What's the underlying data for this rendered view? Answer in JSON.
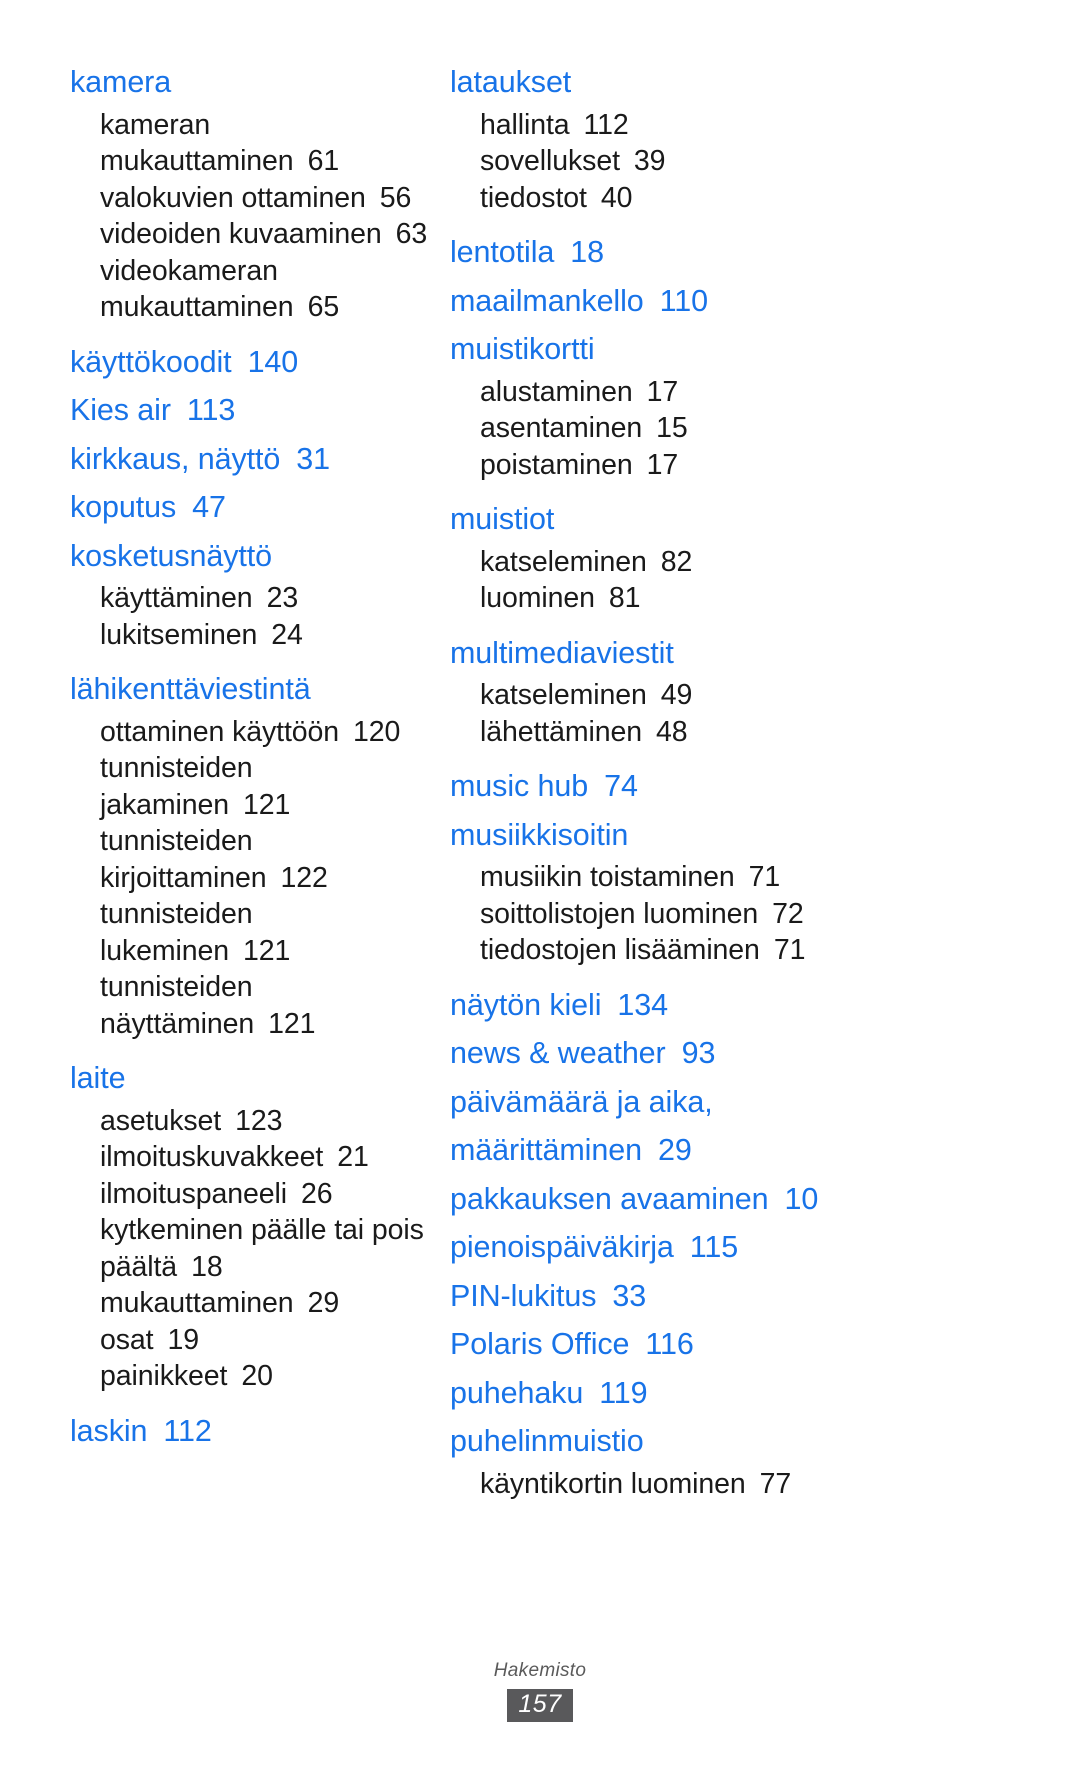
{
  "document": {
    "type": "index-page",
    "footer_label": "Hakemisto",
    "page_number": "157",
    "accent_color": "#1873e8",
    "text_color": "#1a1a1a",
    "footer_badge_color": "#59595b"
  },
  "left_column": {
    "groups": [
      {
        "heading": "kamera",
        "heading_page": "",
        "subs": [
          {
            "label": "kameran",
            "page": ""
          },
          {
            "label": "mukauttaminen",
            "page": "61"
          },
          {
            "label": "valokuvien ottaminen",
            "page": "56"
          },
          {
            "label": "videoiden kuvaaminen",
            "page": "63"
          },
          {
            "label": "videokameran",
            "page": ""
          },
          {
            "label": "mukauttaminen",
            "page": "65"
          }
        ]
      },
      {
        "heading": "käyttökoodit",
        "heading_page": "140",
        "subs": []
      },
      {
        "heading": "Kies air",
        "heading_page": "113",
        "subs": []
      },
      {
        "heading": "kirkkaus, näyttö",
        "heading_page": "31",
        "subs": []
      },
      {
        "heading": "koputus",
        "heading_page": "47",
        "subs": []
      },
      {
        "heading": "kosketusnäyttö",
        "heading_page": "",
        "subs": [
          {
            "label": "käyttäminen",
            "page": "23"
          },
          {
            "label": "lukitseminen",
            "page": "24"
          }
        ]
      },
      {
        "heading": "lähikenttäviestintä",
        "heading_page": "",
        "subs": [
          {
            "label": "ottaminen käyttöön",
            "page": "120"
          },
          {
            "label": "tunnisteiden",
            "page": ""
          },
          {
            "label": "jakaminen",
            "page": "121"
          },
          {
            "label": "tunnisteiden",
            "page": ""
          },
          {
            "label": "kirjoittaminen",
            "page": "122"
          },
          {
            "label": "tunnisteiden",
            "page": ""
          },
          {
            "label": "lukeminen",
            "page": "121"
          },
          {
            "label": "tunnisteiden",
            "page": ""
          },
          {
            "label": "näyttäminen",
            "page": "121"
          }
        ]
      },
      {
        "heading": "laite",
        "heading_page": "",
        "subs": [
          {
            "label": "asetukset",
            "page": "123"
          },
          {
            "label": "ilmoituskuvakkeet",
            "page": "21"
          },
          {
            "label": "ilmoituspaneeli",
            "page": "26"
          },
          {
            "label": "kytkeminen päälle tai pois",
            "page": ""
          },
          {
            "label": "päältä",
            "page": "18"
          },
          {
            "label": "mukauttaminen",
            "page": "29"
          },
          {
            "label": "osat",
            "page": "19"
          },
          {
            "label": "painikkeet",
            "page": "20"
          }
        ]
      },
      {
        "heading": "laskin",
        "heading_page": "112",
        "subs": []
      }
    ]
  },
  "right_column": {
    "groups": [
      {
        "heading": "lataukset",
        "heading_page": "",
        "subs": [
          {
            "label": "hallinta",
            "page": "112"
          },
          {
            "label": "sovellukset",
            "page": "39"
          },
          {
            "label": "tiedostot",
            "page": "40"
          }
        ]
      },
      {
        "heading": "lentotila",
        "heading_page": "18",
        "subs": []
      },
      {
        "heading": "maailmankello",
        "heading_page": "110",
        "subs": []
      },
      {
        "heading": "muistikortti",
        "heading_page": "",
        "subs": [
          {
            "label": "alustaminen",
            "page": "17"
          },
          {
            "label": "asentaminen",
            "page": "15"
          },
          {
            "label": "poistaminen",
            "page": "17"
          }
        ]
      },
      {
        "heading": "muistiot",
        "heading_page": "",
        "subs": [
          {
            "label": "katseleminen",
            "page": "82"
          },
          {
            "label": "luominen",
            "page": "81"
          }
        ]
      },
      {
        "heading": "multimediaviestit",
        "heading_page": "",
        "subs": [
          {
            "label": "katseleminen",
            "page": "49"
          },
          {
            "label": "lähettäminen",
            "page": "48"
          }
        ]
      },
      {
        "heading": "music hub",
        "heading_page": "74",
        "subs": []
      },
      {
        "heading": "musiikkisoitin",
        "heading_page": "",
        "subs": [
          {
            "label": "musiikin toistaminen",
            "page": "71"
          },
          {
            "label": "soittolistojen luominen",
            "page": "72"
          },
          {
            "label": "tiedostojen lisääminen",
            "page": "71"
          }
        ]
      },
      {
        "heading": "näytön kieli",
        "heading_page": "134",
        "subs": []
      },
      {
        "heading": "news & weather",
        "heading_page": "93",
        "subs": []
      },
      {
        "heading": "päivämäärä ja aika,",
        "heading_page": "",
        "subs": []
      },
      {
        "heading": "määrittäminen",
        "heading_page": "29",
        "subs": []
      },
      {
        "heading": "pakkauksen avaaminen",
        "heading_page": "10",
        "subs": []
      },
      {
        "heading": "pienoispäiväkirja",
        "heading_page": "115",
        "subs": []
      },
      {
        "heading": "PIN-lukitus",
        "heading_page": "33",
        "subs": []
      },
      {
        "heading": "Polaris Office",
        "heading_page": "116",
        "subs": []
      },
      {
        "heading": "puhehaku",
        "heading_page": "119",
        "subs": []
      },
      {
        "heading": "puhelinmuistio",
        "heading_page": "",
        "subs": [
          {
            "label": "käyntikortin luominen",
            "page": "77"
          }
        ]
      }
    ]
  }
}
